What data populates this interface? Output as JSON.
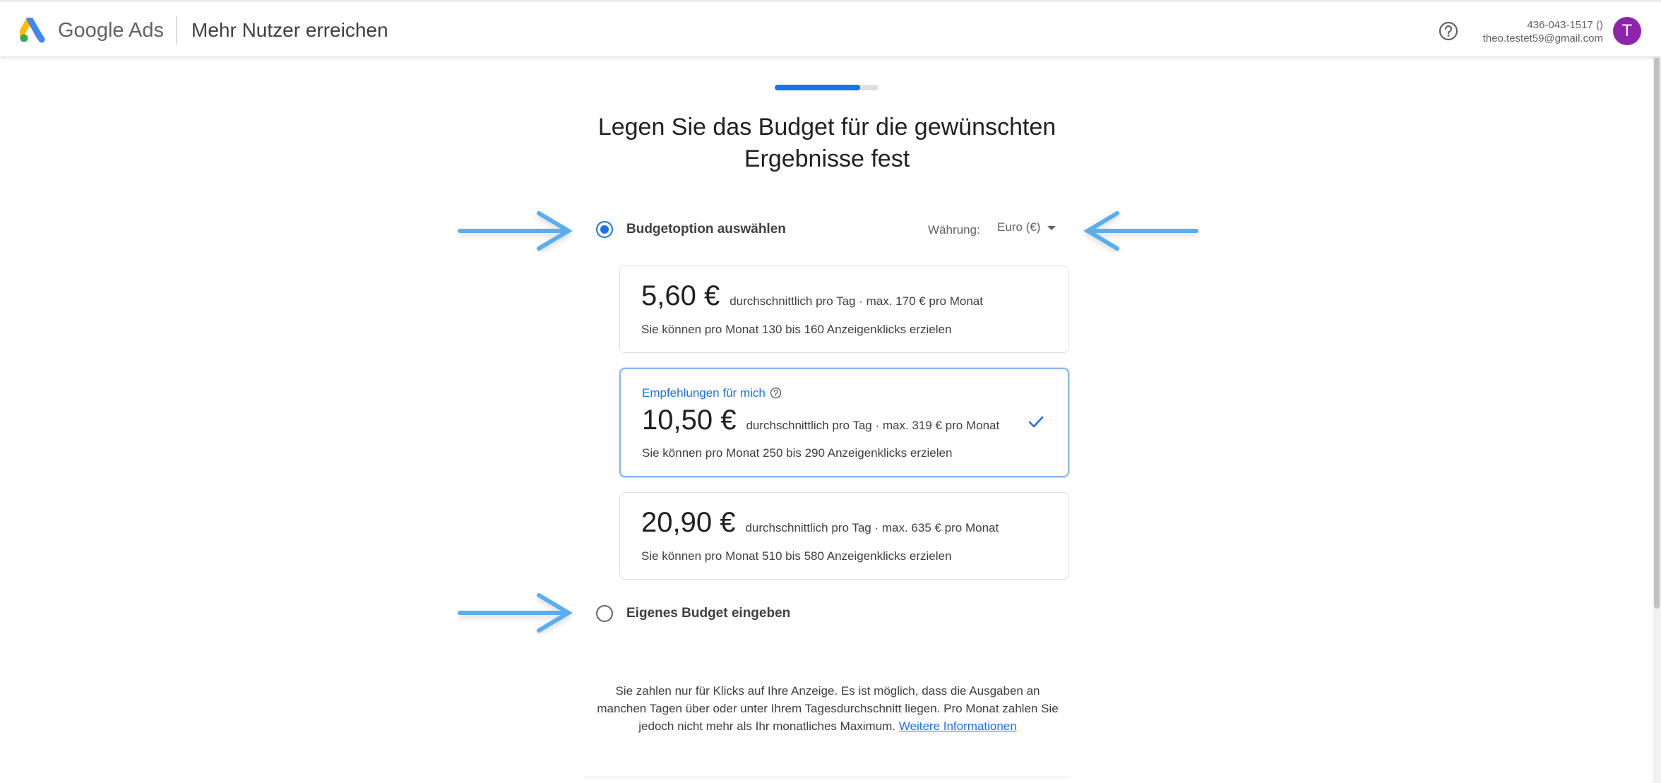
{
  "header": {
    "brand_google": "Google",
    "brand_ads": "Ads",
    "title": "Mehr Nutzer erreichen",
    "account_id": "436-043-1517 ()",
    "account_email": "theo.testet59@gmail.com",
    "avatar_letter": "T"
  },
  "progress": {
    "fraction": 0.82
  },
  "page_title": "Legen Sie das Budget für die gewünschten Ergebnisse fest",
  "budget_option": {
    "label": "Budgetoption auswählen",
    "selected": true
  },
  "currency": {
    "label": "Währung:",
    "value": "Euro (€)"
  },
  "cards": [
    {
      "amount": "5,60 €",
      "meta": "durchschnittlich pro Tag ·  max. 170 € pro Monat",
      "clicks": "Sie können pro Monat 130 bis 160 Anzeigenklicks erzielen"
    },
    {
      "recommendation": "Empfehlungen für mich",
      "amount": "10,50 €",
      "meta": "durchschnittlich pro Tag ·  max. 319 € pro Monat",
      "clicks": "Sie können pro Monat 250 bis 290 Anzeigenklicks erzielen",
      "selected": true
    },
    {
      "amount": "20,90 €",
      "meta": "durchschnittlich pro Tag ·  max. 635 € pro Monat",
      "clicks": "Sie können pro Monat 510 bis 580 Anzeigenklicks erzielen"
    }
  ],
  "custom_budget": {
    "label": "Eigenes Budget eingeben",
    "selected": false
  },
  "footer": {
    "text": "Sie zahlen nur für Klicks auf Ihre Anzeige. Es ist möglich, dass die Ausgaben an manchen Tagen über oder unter Ihrem Tagesdurchschnitt liegen. Pro Monat zahlen Sie jedoch nicht mehr als Ihr monatliches Maximum.",
    "link": "Weitere Informationen"
  },
  "colors": {
    "accent": "#1a73e8",
    "avatar": "#8e24aa",
    "annotation_arrow": "#5aaef0"
  },
  "icons": [
    "google-ads-logo-icon",
    "help-icon",
    "dropdown-caret-icon",
    "info-question-icon",
    "checkmark-icon",
    "annotation-arrow-icon"
  ]
}
